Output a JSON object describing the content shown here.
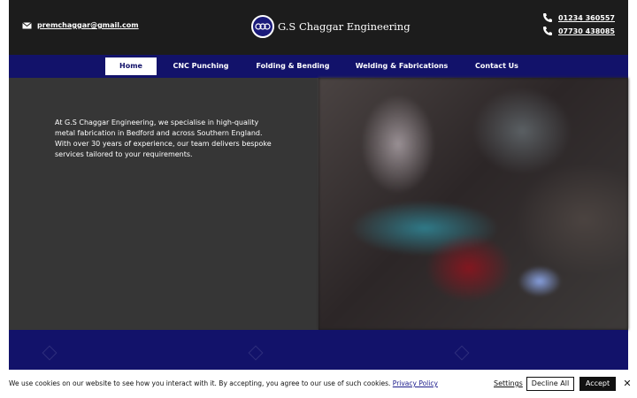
{
  "header": {
    "email": "premchaggar@gmail.com",
    "logo_text": "G.S Chaggar Engineering",
    "phones": [
      "01234 360557",
      "07730 438085"
    ]
  },
  "nav": {
    "items": [
      {
        "label": "Home",
        "active": true
      },
      {
        "label": "CNC Punching",
        "active": false
      },
      {
        "label": "Folding & Bending",
        "active": false
      },
      {
        "label": "Welding & Fabrications",
        "active": false
      },
      {
        "label": "Contact Us",
        "active": false
      }
    ]
  },
  "hero": {
    "text": "At G.S Chaggar Engineering, we specialise in high-quality metal fabrication in Bedford and across Southern England. With over 30 years of experience, our team delivers bespoke services tailored to your requirements."
  },
  "cookie_banner": {
    "text": "We use cookies on our website to see how you interact with it. By accepting, you agree to our use of such cookies.",
    "privacy_link": "Privacy Policy",
    "settings_label": "Settings",
    "decline_label": "Decline All",
    "accept_label": "Accept",
    "close_icon": "close-icon"
  },
  "colors": {
    "nav_bg": "#12126a",
    "header_bg": "#1c1c1c",
    "hero_left_bg": "#363636"
  }
}
